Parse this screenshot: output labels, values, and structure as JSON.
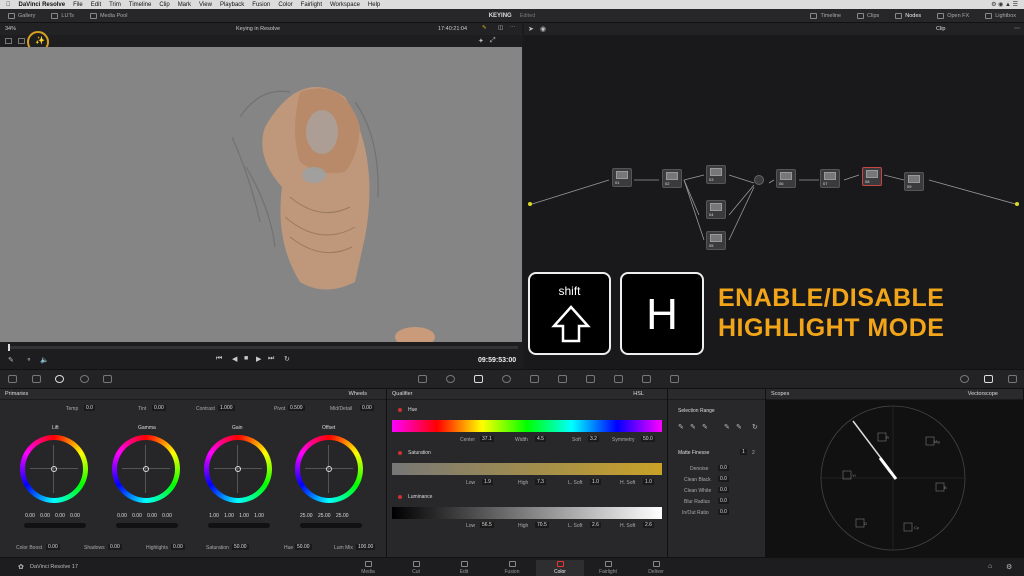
{
  "menubar": {
    "app": "DaVinci Resolve",
    "items": [
      "File",
      "Edit",
      "Trim",
      "Timeline",
      "Clip",
      "Mark",
      "View",
      "Playback",
      "Fusion",
      "Color",
      "Fairlight",
      "Workspace",
      "Help"
    ]
  },
  "toolbar": {
    "left": [
      "Gallery",
      "LUTs",
      "Media Pool"
    ],
    "project": "KEYING",
    "status": "Edited",
    "right": [
      "Timeline",
      "Clips",
      "Nodes",
      "Open FX",
      "Lightbox"
    ]
  },
  "viewer": {
    "zoom": "34%",
    "clip_name": "Keying in Resolve",
    "timecode": "17:40:21:04",
    "playhead_tc": "09:59:53:00"
  },
  "nodes": {
    "mode": "Clip",
    "labels": [
      "01",
      "02",
      "03",
      "04",
      "05",
      "06",
      "07",
      "08",
      "09"
    ]
  },
  "overlay": {
    "key1_small": "shift",
    "key2": "H",
    "line1": "ENABLE/DISABLE",
    "line2": "HIGHLIGHT MODE"
  },
  "primaries": {
    "title": "Primaries",
    "mode": "Wheels",
    "top_labels": {
      "temp": "Temp",
      "temp_v": "0.0",
      "tint": "Tint",
      "tint_v": "0.00",
      "contrast": "Contrast",
      "contrast_v": "1.000",
      "pivot": "Pivot",
      "pivot_v": "0.500",
      "mid": "Mid/Detail",
      "mid_v": "0.00"
    },
    "wheels": [
      {
        "name": "Lift",
        "vals": [
          "0.00",
          "0.00",
          "0.00",
          "0.00"
        ]
      },
      {
        "name": "Gamma",
        "vals": [
          "0.00",
          "0.00",
          "0.00",
          "0.00"
        ]
      },
      {
        "name": "Gain",
        "vals": [
          "1.00",
          "1.00",
          "1.00",
          "1.00"
        ]
      },
      {
        "name": "Offset",
        "vals": [
          "25.00",
          "25.00",
          "25.00"
        ]
      }
    ],
    "bottom": {
      "cb": "Color Boost",
      "cb_v": "0.00",
      "sh": "Shadows",
      "sh_v": "0.00",
      "hl": "Highlights",
      "hl_v": "0.00",
      "sat": "Saturation",
      "sat_v": "50.00",
      "hue": "Hue",
      "hue_v": "50.00",
      "lm": "Lum Mix",
      "lm_v": "100.00"
    }
  },
  "qualifier": {
    "title": "Qualifier",
    "mode": "HSL",
    "hue": {
      "label": "Hue",
      "center": "Center",
      "center_v": "37.1",
      "width": "Width",
      "width_v": "4.5",
      "soft": "Soft",
      "soft_v": "3.2",
      "sym": "Symmetry",
      "sym_v": "50.0"
    },
    "sat": {
      "label": "Saturation",
      "low": "Low",
      "low_v": "1.9",
      "high": "High",
      "high_v": "7.3",
      "ls": "L. Soft",
      "ls_v": "1.0",
      "hs": "H. Soft",
      "hs_v": "1.0"
    },
    "lum": {
      "label": "Luminance",
      "low": "Low",
      "low_v": "56.5",
      "high": "High",
      "high_v": "70.5",
      "ls": "L. Soft",
      "ls_v": "2.6",
      "hs": "H. Soft",
      "hs_v": "2.6"
    }
  },
  "selection": {
    "title": "Selection Range",
    "page": "1",
    "page2": "2",
    "matte": "Matte Finesse",
    "rows": [
      {
        "k": "Denoise",
        "v": "0.0"
      },
      {
        "k": "Clean Black",
        "v": "0.0"
      },
      {
        "k": "Clean White",
        "v": "0.0"
      },
      {
        "k": "Blur Radius",
        "v": "0.0"
      },
      {
        "k": "In/Out Ratio",
        "v": "0.0"
      }
    ]
  },
  "scopes": {
    "title": "Scopes",
    "type": "Vectorscope",
    "targets": [
      "R",
      "Mg",
      "Yl",
      "B",
      "G",
      "Cy"
    ]
  },
  "pagebar": {
    "version": "DaVinci Resolve 17",
    "pages": [
      "Media",
      "Cut",
      "Edit",
      "Fusion",
      "Color",
      "Fairlight",
      "Deliver"
    ],
    "active": "Color"
  }
}
